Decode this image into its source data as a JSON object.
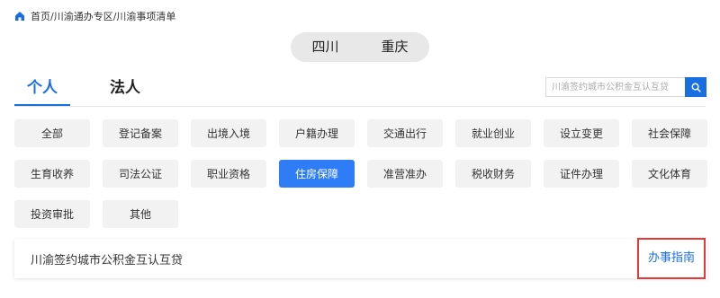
{
  "breadcrumb": {
    "text": "首页/川渝通办专区/川渝事项清单"
  },
  "region": {
    "options": [
      "四川",
      "重庆"
    ]
  },
  "tabs": [
    {
      "label": "个人",
      "active": true
    },
    {
      "label": "法人",
      "active": false
    }
  ],
  "search": {
    "placeholder": "川渝签约城市公积金互认互贷"
  },
  "categories": {
    "items": [
      "全部",
      "登记备案",
      "出境入境",
      "户籍办理",
      "交通出行",
      "就业创业",
      "设立变更",
      "社会保障",
      "生育收养",
      "司法公证",
      "职业资格",
      "住房保障",
      "准营准办",
      "税收财务",
      "证件办理",
      "文化体育",
      "投资审批",
      "其他"
    ],
    "active": "住房保障"
  },
  "results": [
    {
      "title": "川渝签约城市公积金互认互贷",
      "action": "办事指南"
    }
  ],
  "colors": {
    "accent": "#1a6fe0",
    "active_button": "#2f7df6",
    "highlight_border": "#e53935"
  },
  "icons": {
    "breadcrumb": "home-icon",
    "search": "search-icon"
  }
}
